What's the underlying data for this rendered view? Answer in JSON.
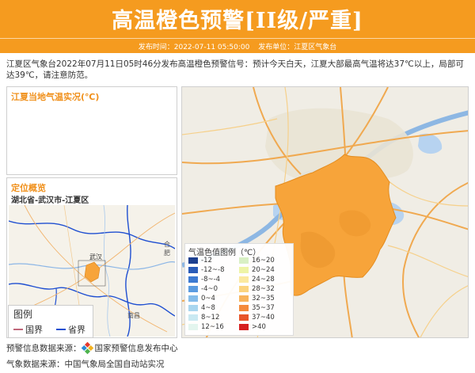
{
  "header": {
    "title": "高温橙色预警[II级/严重]",
    "publish_time_label": "发布时间：2022-07-11 05:50:00",
    "publisher_label": "发布单位：江夏区气象台"
  },
  "description": "江夏区气象台2022年07月11日05时46分发布高温橙色预警信号：预计今天白天，江夏大部最高气温将达37℃以上，局部可达39℃，请注意防范。",
  "temp_panel": {
    "title": "江夏当地气温实况(℃)"
  },
  "location_panel": {
    "title": "定位概览",
    "subtitle": "湖北省-武汉市-江夏区",
    "map_labels": [
      "合肥",
      "武汉",
      "南昌"
    ],
    "legend": {
      "title": "图例",
      "items": [
        {
          "label": "国界",
          "color": "#c0667a"
        },
        {
          "label": "省界",
          "color": "#1f4fd1"
        }
      ]
    }
  },
  "main_map": {
    "legend_title": "气温色值图例（℃）",
    "legend_left": [
      {
        "label": "-12",
        "color": "#1c3f8f"
      },
      {
        "label": "-12~-8",
        "color": "#2a5cb8"
      },
      {
        "label": "-8~-4",
        "color": "#3d7ad1"
      },
      {
        "label": "-4~0",
        "color": "#5b9be0"
      },
      {
        "label": "0~4",
        "color": "#86bdea"
      },
      {
        "label": "4~8",
        "color": "#a9d6ef"
      },
      {
        "label": "8~12",
        "color": "#c9e9f2"
      },
      {
        "label": "12~16",
        "color": "#e3f5ee"
      }
    ],
    "legend_right": [
      {
        "label": "16~20",
        "color": "#d8f0c4"
      },
      {
        "label": "20~24",
        "color": "#eef4a6"
      },
      {
        "label": "24~28",
        "color": "#fbe9a0"
      },
      {
        "label": "28~32",
        "color": "#fbd47f"
      },
      {
        "label": "32~35",
        "color": "#f8b45c"
      },
      {
        "label": "35~37",
        "color": "#f48a3c"
      },
      {
        "label": "37~40",
        "color": "#e8552a"
      },
      {
        "label": ">40",
        "color": "#d61f1f"
      }
    ],
    "district_color": "#f7a43a"
  },
  "footer": {
    "warning_source_label": "预警信息数据来源：",
    "warning_source_name": "国家预警信息发布中心",
    "weather_source": "气象数据来源：中国气象局全国自动站实况"
  }
}
